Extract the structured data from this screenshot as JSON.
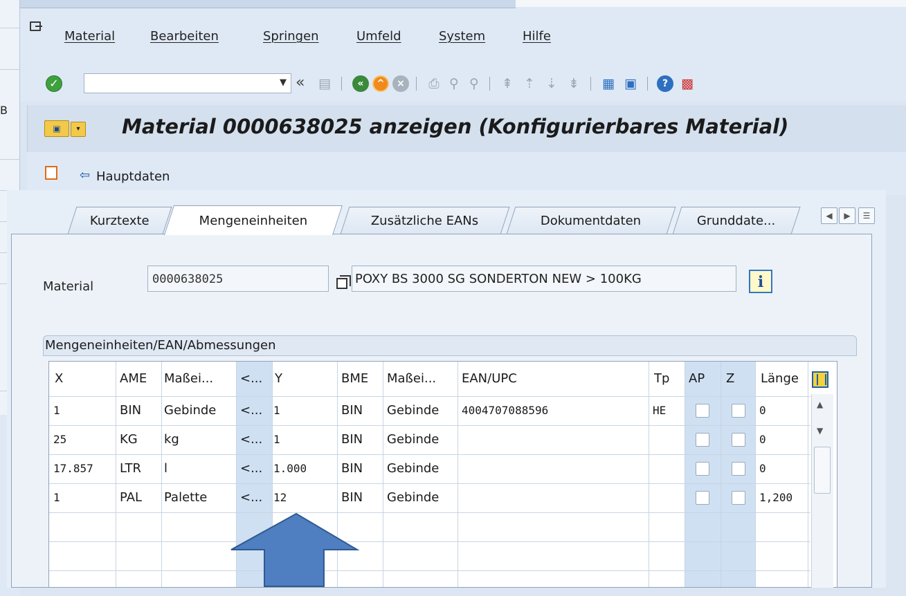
{
  "menu": {
    "items": [
      "Material",
      "Bearbeiten",
      "Springen",
      "Umfeld",
      "System",
      "Hilfe"
    ]
  },
  "toolbar": {
    "command_field_value": "",
    "icons": [
      "enter-icon",
      "back-double-icon",
      "save-icon",
      "back-icon",
      "exit-icon",
      "cancel-icon",
      "print-icon",
      "find-icon",
      "find-next-icon",
      "first-page-icon",
      "previous-page-icon",
      "next-page-icon",
      "last-page-icon",
      "create-session-icon",
      "shortcut-icon",
      "help-icon",
      "customize-layout-icon"
    ]
  },
  "title": {
    "text": "Material 0000638025 anzeigen (Konfigurierbares Material)"
  },
  "appbar": {
    "hauptdaten_label": "Hauptdaten"
  },
  "tabs": [
    {
      "label": "Kurztexte",
      "active": false
    },
    {
      "label": "Mengeneinheiten",
      "active": true
    },
    {
      "label": "Zusätzliche EANs",
      "active": false
    },
    {
      "label": "Dokumentdaten",
      "active": false
    },
    {
      "label": "Grunddate...",
      "active": false
    }
  ],
  "form": {
    "material_label": "Material",
    "material_value": "0000638025",
    "description_value": "POXY BS 3000 SG SONDERTON NEW > 100KG",
    "info_button": "i"
  },
  "group": {
    "title": "Mengeneinheiten/EAN/Abmessungen"
  },
  "table": {
    "columns": [
      "X",
      "AME",
      "Maßei...",
      "<...",
      "Y",
      "BME",
      "Maßei...",
      "EAN/UPC",
      "Tp",
      "AP",
      "Z",
      "Länge"
    ],
    "rows": [
      {
        "x": "1",
        "ame": "BIN",
        "massei": "Gebinde",
        "lt": "<...",
        "y": "1",
        "bme": "BIN",
        "massei2": "Gebinde",
        "ean": "4004707088596",
        "tp": "HE",
        "ap": false,
        "z": false,
        "laenge": "0"
      },
      {
        "x": "25",
        "ame": "KG",
        "massei": "kg",
        "lt": "<...",
        "y": "1",
        "bme": "BIN",
        "massei2": "Gebinde",
        "ean": "",
        "tp": "",
        "ap": false,
        "z": false,
        "laenge": "0"
      },
      {
        "x": "17.857",
        "ame": "LTR",
        "massei": "l",
        "lt": "<...",
        "y": "1.000",
        "bme": "BIN",
        "massei2": "Gebinde",
        "ean": "",
        "tp": "",
        "ap": false,
        "z": false,
        "laenge": "0"
      },
      {
        "x": "1",
        "ame": "PAL",
        "massei": "Palette",
        "lt": "<...",
        "y": "12",
        "bme": "BIN",
        "massei2": "Gebinde",
        "ean": "",
        "tp": "",
        "ap": false,
        "z": false,
        "laenge": "1,200"
      }
    ]
  },
  "background_window": {
    "letter": "B"
  },
  "colors": {
    "accent_blue": "#4a78b5",
    "arrow_fill": "#4f7fc0",
    "selected_column": "#cfe0f3"
  }
}
